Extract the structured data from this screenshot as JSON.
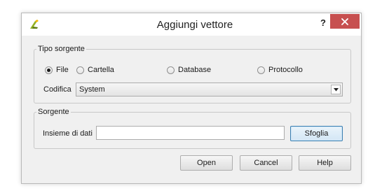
{
  "window": {
    "title": "Aggiungi vettore",
    "help_label": "?",
    "close_color": "#c75050",
    "app_icon": "qgis-logo-icon"
  },
  "source_type": {
    "legend": "Tipo sorgente",
    "options": [
      {
        "label": "File",
        "checked": true
      },
      {
        "label": "Cartella",
        "checked": false
      },
      {
        "label": "Database",
        "checked": false
      },
      {
        "label": "Protocollo",
        "checked": false
      }
    ],
    "encoding_label": "Codifica",
    "encoding_value": "System"
  },
  "source": {
    "legend": "Sorgente",
    "dataset_label": "Insieme di dati",
    "dataset_value": "",
    "browse_label": "Sfoglia"
  },
  "footer": {
    "open_label": "Open",
    "cancel_label": "Cancel",
    "help_label": "Help"
  },
  "colors": {
    "accent": "#3c7fb1",
    "window_bg": "#f0f0f0"
  }
}
